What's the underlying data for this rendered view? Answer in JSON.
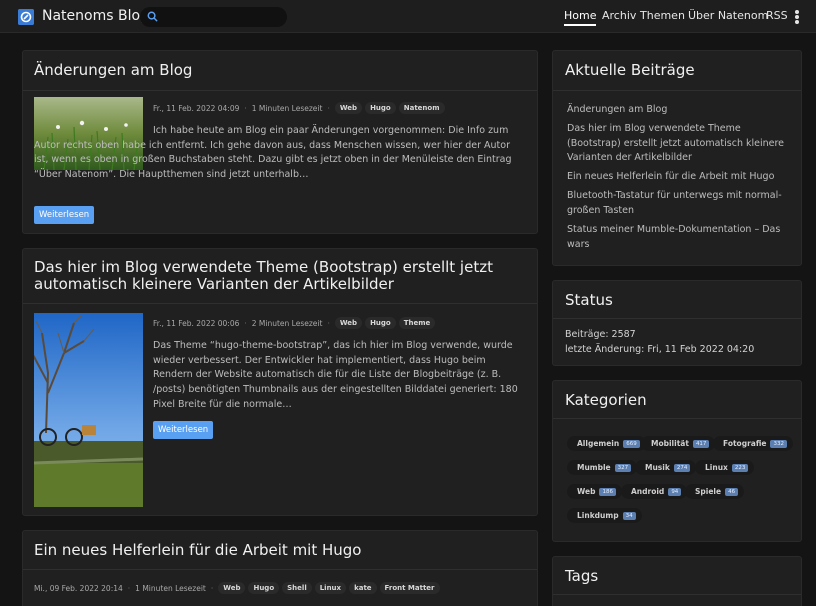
{
  "brand": "Natenoms Blog",
  "search": {
    "placeholder": "",
    "value": ""
  },
  "nav": [
    {
      "label": "Home",
      "active": true
    },
    {
      "label": "Archiv"
    },
    {
      "label": "Themen"
    },
    {
      "label": "Über Natenom"
    },
    {
      "label": "RSS"
    }
  ],
  "posts": [
    {
      "title": "Änderungen am Blog",
      "date": "Fr., 11 Feb. 2022 04:09",
      "reading": "1 Minuten Lesezeit",
      "tags": [
        "Web",
        "Hugo",
        "Natenom"
      ],
      "excerpt": "Ich habe heute am Blog ein paar Änderungen vorgenommen: Die Info zum Autor rechts oben habe ich entfernt. Ich gehe davon aus, dass Menschen wissen, wer hier der Autor ist, wenn es oben in großen Buchstaben steht. Dazu gibt es jetzt oben in der Menüleiste den Eintrag “Über Natenom”. Die Hauptthemen sind jetzt unterhalb…",
      "button": "Weiterlesen"
    },
    {
      "title": "Das hier im Blog verwendete Theme (Bootstrap) erstellt jetzt automatisch kleinere Varianten der Artikelbilder",
      "date": "Fr., 11 Feb. 2022 00:06",
      "reading": "2 Minuten Lesezeit",
      "tags": [
        "Web",
        "Hugo",
        "Theme"
      ],
      "excerpt": "Das Theme “hugo-theme-bootstrap”, das ich hier im Blog verwende, wurde wieder verbessert. Der Entwickler hat implementiert, dass Hugo beim Rendern der Website automatisch die für die Liste der Blogbeiträge (z. B. /posts) benötigten Thumbnails aus der eingestellten Bilddatei generiert: 180 Pixel Breite für die normale…",
      "button": "Weiterlesen"
    },
    {
      "title": "Ein neues Helferlein für die Arbeit mit Hugo",
      "date": "Mi., 09 Feb. 2022 20:14",
      "reading": "1 Minuten Lesezeit",
      "tags": [
        "Web",
        "Hugo",
        "Shell",
        "Linux",
        "kate",
        "Front Matter"
      ]
    }
  ],
  "sidebar": {
    "recent": {
      "title": "Aktuelle Beiträge",
      "items": [
        "Änderungen am Blog",
        "Das hier im Blog verwendete Theme (Bootstrap) erstellt jetzt automatisch kleinere Varianten der Artikelbilder",
        "Ein neues Helferlein für die Arbeit mit Hugo",
        "Bluetooth-Tastatur für unterwegs mit normal-großen Tasten",
        "Status meiner Mumble-Dokumentation – Das wars"
      ]
    },
    "status": {
      "title": "Status",
      "posts_label": "Beiträge: 2587",
      "last_change": "letzte Änderung: Fri, 11 Feb 2022 04:20"
    },
    "categories": {
      "title": "Kategorien",
      "items": [
        {
          "name": "Allgemein",
          "count": "669"
        },
        {
          "name": "Mobilität",
          "count": "417"
        },
        {
          "name": "Fotografie",
          "count": "332"
        },
        {
          "name": "Mumble",
          "count": "327"
        },
        {
          "name": "Musik",
          "count": "274"
        },
        {
          "name": "Linux",
          "count": "223"
        },
        {
          "name": "Web",
          "count": "186"
        },
        {
          "name": "Android",
          "count": "94"
        },
        {
          "name": "Spiele",
          "count": "46"
        },
        {
          "name": "Linkdump",
          "count": "34"
        }
      ]
    },
    "tags": {
      "title": "Tags"
    }
  },
  "colors": {
    "accent": "#5aa0f2",
    "background": "#141414",
    "card": "#202020",
    "badge": "#5b7fb0"
  }
}
